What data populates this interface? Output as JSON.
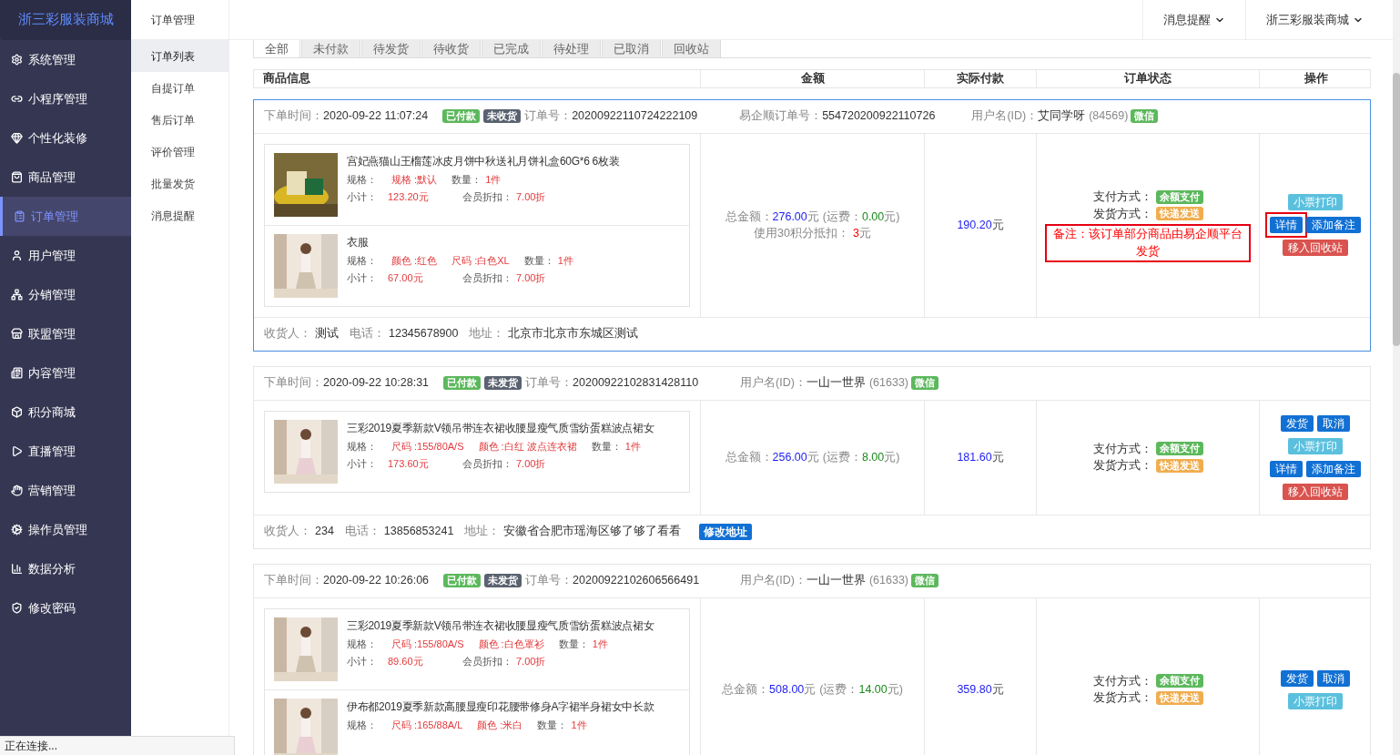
{
  "sidebar": {
    "logo": "浙三彩服装商城",
    "items": [
      {
        "label": "系统管理",
        "selected": false
      },
      {
        "label": "小程序管理",
        "selected": false
      },
      {
        "label": "个性化装修",
        "selected": false
      },
      {
        "label": "商品管理",
        "selected": false
      },
      {
        "label": "订单管理",
        "selected": true
      },
      {
        "label": "用户管理",
        "selected": false
      },
      {
        "label": "分销管理",
        "selected": false
      },
      {
        "label": "联盟管理",
        "selected": false
      },
      {
        "label": "内容管理",
        "selected": false
      },
      {
        "label": "积分商城",
        "selected": false
      },
      {
        "label": "直播管理",
        "selected": false
      },
      {
        "label": "营销管理",
        "selected": false
      },
      {
        "label": "操作员管理",
        "selected": false
      },
      {
        "label": "数据分析",
        "selected": false
      },
      {
        "label": "修改密码",
        "selected": false
      }
    ]
  },
  "submenu": {
    "title": "订单管理",
    "items": [
      {
        "label": "订单列表",
        "selected": true
      },
      {
        "label": "自提订单",
        "selected": false
      },
      {
        "label": "售后订单",
        "selected": false
      },
      {
        "label": "评价管理",
        "selected": false
      },
      {
        "label": "批量发货",
        "selected": false
      },
      {
        "label": "消息提醒",
        "selected": false
      }
    ]
  },
  "topbar": {
    "items": [
      "消息提醒",
      "浙三彩服装商城"
    ]
  },
  "tabs": [
    {
      "label": "全部",
      "selected": true
    },
    {
      "label": "未付款",
      "selected": false
    },
    {
      "label": "待发货",
      "selected": false
    },
    {
      "label": "待收货",
      "selected": false
    },
    {
      "label": "已完成",
      "selected": false
    },
    {
      "label": "待处理",
      "selected": false
    },
    {
      "label": "已取消",
      "selected": false
    },
    {
      "label": "回收站",
      "selected": false
    }
  ],
  "table": {
    "columns": [
      "商品信息",
      "金额",
      "实际付款",
      "订单状态",
      "操作"
    ],
    "orders": [
      {
        "highlighted": true,
        "time_label": "下单时间：",
        "time": "2020-09-22 11:07:24",
        "badges": [
          {
            "text": "已付款",
            "color": "#5cb85c"
          },
          {
            "text": "未收货",
            "color": "#5a6270"
          }
        ],
        "order_no_label": "订单号：",
        "order_no": "20200922110724222109",
        "extra_no_label": "易企顺订单号：",
        "extra_no": "554720200922110726",
        "user_label": "用户名(ID)：",
        "user": "艾同学呀",
        "user_id": "(84569)",
        "user_tag": "微信",
        "products": [
          {
            "name": "宫妃燕猫山王榴莲冰皮月饼中秋送礼月饼礼盒60G*6 6枚装",
            "specs_label": "规格：",
            "specs": [
              "规格 :默认"
            ],
            "qty_label": "数量：",
            "qty": "1件",
            "subtotal_label": "小计：",
            "subtotal": "123.20元",
            "discount_label": "会员折扣：",
            "discount": "7.00折"
          },
          {
            "name": "衣服",
            "specs_label": "规格：",
            "specs": [
              "颜色 :红色",
              "尺码 :白色XL"
            ],
            "qty_label": "数量：",
            "qty": "1件",
            "subtotal_label": "小计：",
            "subtotal": "67.00元",
            "discount_label": "会员折扣：",
            "discount": "7.00折"
          }
        ],
        "amount": {
          "total_label": "总金额：",
          "total": "276.00",
          "unit": "元",
          "ship_label": "(运费：",
          "ship": "0.00",
          "ship_end": "元)",
          "points_label": "使用30积分抵扣：",
          "points": "3",
          "points_unit": "元"
        },
        "paid": "190.20",
        "paid_unit": "元",
        "pay_label": "支付方式：",
        "pay": "余额支付",
        "ship_method_label": "发货方式：",
        "ship_method": "快递发送",
        "remark": "备注：该订单部分商品由易企顺平台发货",
        "actions": [
          [
            {
              "label": "小票打印",
              "kind": "info",
              "highlighted": false
            }
          ],
          [
            {
              "label": "详情",
              "kind": "primary",
              "highlighted": true
            },
            {
              "label": "添加备注",
              "kind": "primary",
              "highlighted": false
            }
          ],
          [
            {
              "label": "移入回收站",
              "kind": "danger",
              "highlighted": false
            }
          ]
        ],
        "receiver": {
          "name_label": "收货人：",
          "name": "测试",
          "phone_label": "电话：",
          "phone": "12345678900",
          "address_label": "地址：",
          "address": "北京市北京市东城区测试"
        }
      },
      {
        "highlighted": false,
        "time_label": "下单时间：",
        "time": "2020-09-22 10:28:31",
        "badges": [
          {
            "text": "已付款",
            "color": "#5cb85c"
          },
          {
            "text": "未发货",
            "color": "#5a6270"
          }
        ],
        "order_no_label": "订单号：",
        "order_no": "20200922102831428110",
        "user_label": "用户名(ID)：",
        "user": "一山一世界",
        "user_id": "(61633)",
        "user_tag": "微信",
        "products": [
          {
            "name": "三彩2019夏季新款V领吊带连衣裙收腰显瘦气质雪纺蛋糕波点裙女",
            "specs_label": "规格：",
            "specs": [
              "尺码 :155/80A/S",
              "颜色 :白红 波点连衣裙"
            ],
            "qty_label": "数量：",
            "qty": "1件",
            "subtotal_label": "小计：",
            "subtotal": "173.60元",
            "discount_label": "会员折扣：",
            "discount": "7.00折"
          }
        ],
        "amount": {
          "total_label": "总金额：",
          "total": "256.00",
          "unit": "元",
          "ship_label": "(运费：",
          "ship": "8.00",
          "ship_end": "元)"
        },
        "paid": "181.60",
        "paid_unit": "元",
        "pay_label": "支付方式：",
        "pay": "余额支付",
        "ship_method_label": "发货方式：",
        "ship_method": "快递发送",
        "actions": [
          [
            {
              "label": "发货",
              "kind": "primary",
              "highlighted": false
            },
            {
              "label": "取消",
              "kind": "primary",
              "highlighted": false
            }
          ],
          [
            {
              "label": "小票打印",
              "kind": "info",
              "highlighted": false
            }
          ],
          [
            {
              "label": "详情",
              "kind": "primary",
              "highlighted": false
            },
            {
              "label": "添加备注",
              "kind": "primary",
              "highlighted": false
            }
          ],
          [
            {
              "label": "移入回收站",
              "kind": "danger",
              "highlighted": false
            }
          ]
        ],
        "receiver": {
          "name_label": "收货人：",
          "name": "234",
          "phone_label": "电话：",
          "phone": "13856853241",
          "address_label": "地址：",
          "address": "安徽省合肥市瑶海区够了够了看看",
          "edit_button": "修改地址"
        }
      },
      {
        "highlighted": false,
        "time_label": "下单时间：",
        "time": "2020-09-22 10:26:06",
        "badges": [
          {
            "text": "已付款",
            "color": "#5cb85c"
          },
          {
            "text": "未发货",
            "color": "#5a6270"
          }
        ],
        "order_no_label": "订单号：",
        "order_no": "20200922102606566491",
        "user_label": "用户名(ID)：",
        "user": "一山一世界",
        "user_id": "(61633)",
        "user_tag": "微信",
        "products": [
          {
            "name": "三彩2019夏季新款V领吊带连衣裙收腰显瘦气质雪纺蛋糕波点裙女",
            "specs_label": "规格：",
            "specs": [
              "尺码 :155/80A/S",
              "颜色 :白色罩衫"
            ],
            "qty_label": "数量：",
            "qty": "1件",
            "subtotal_label": "小计：",
            "subtotal": "89.60元",
            "discount_label": "会员折扣：",
            "discount": "7.00折"
          },
          {
            "name": "伊布都2019夏季新款高腰显瘦印花腰带修身A字裙半身裙女中长款",
            "specs_label": "规格：",
            "specs": [
              "尺码 :165/88A/L",
              "颜色 :米白"
            ],
            "qty_label": "数量：",
            "qty": "1件"
          }
        ],
        "amount": {
          "total_label": "总金额：",
          "total": "508.00",
          "unit": "元",
          "ship_label": "(运费：",
          "ship": "14.00",
          "ship_end": "元)"
        },
        "paid": "359.80",
        "paid_unit": "元",
        "pay_label": "支付方式：",
        "pay": "余额支付",
        "ship_method_label": "发货方式：",
        "ship_method": "快递发送",
        "actions": [
          [
            {
              "label": "发货",
              "kind": "primary",
              "highlighted": false
            },
            {
              "label": "取消",
              "kind": "primary",
              "highlighted": false
            }
          ],
          [
            {
              "label": "小票打印",
              "kind": "info",
              "highlighted": false
            }
          ]
        ]
      }
    ]
  },
  "status_bar": "正在连接..."
}
